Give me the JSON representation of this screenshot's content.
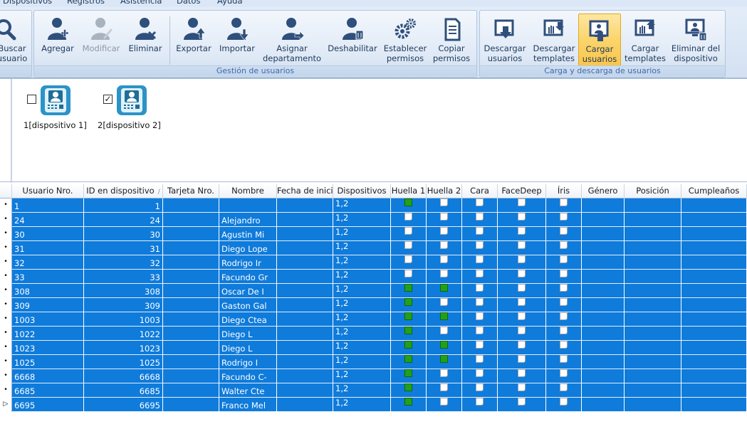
{
  "menu": [
    "Dispositivos",
    "Registros",
    "Asistencia",
    "Datos",
    "Ayuda"
  ],
  "ribbon": {
    "search": {
      "label1": "Buscar",
      "label2": "usuario"
    },
    "user_group": {
      "label": "Gestión de usuarios",
      "buttons": [
        {
          "l1": "Agregar",
          "l2": "",
          "icon": "add-user-icon",
          "disabled": false
        },
        {
          "l1": "Modificar",
          "l2": "",
          "icon": "edit-user-icon",
          "disabled": true
        },
        {
          "l1": "Eliminar",
          "l2": "",
          "icon": "delete-user-icon",
          "disabled": false
        },
        {
          "l1": "Exportar",
          "l2": "",
          "icon": "export-user-icon",
          "disabled": false
        },
        {
          "l1": "Importar",
          "l2": "",
          "icon": "import-user-icon",
          "disabled": false
        },
        {
          "l1": "Asignar",
          "l2": "departamento",
          "icon": "assign-department-icon",
          "disabled": false
        },
        {
          "l1": "Deshabilitar",
          "l2": "",
          "icon": "disable-user-icon",
          "disabled": false
        },
        {
          "l1": "Establecer",
          "l2": "permisos",
          "icon": "gears-icon",
          "disabled": false
        },
        {
          "l1": "Copiar",
          "l2": "permisos",
          "icon": "copy-document-icon",
          "disabled": false
        }
      ]
    },
    "transfer_group": {
      "label": "Carga y descarga de usuarios",
      "buttons": [
        {
          "l1": "Descargar",
          "l2": "usuarios",
          "icon": "download-users-icon"
        },
        {
          "l1": "Descargar",
          "l2": "templates",
          "icon": "download-templates-icon"
        },
        {
          "l1": "Cargar",
          "l2": "usuarios",
          "icon": "upload-users-icon"
        },
        {
          "l1": "Cargar",
          "l2": "templates",
          "icon": "upload-templates-icon"
        },
        {
          "l1": "Eliminar del",
          "l2": "dispositivo",
          "icon": "delete-from-device-icon"
        }
      ]
    },
    "colors": {
      "active": "#fbd46a",
      "icon_blue": "#2f4f7c"
    }
  },
  "devices": [
    {
      "label": "1[dispositivo 1]",
      "checked": false,
      "icon": "terminal-device-icon"
    },
    {
      "label": "2[dispositivo 2]",
      "checked": true,
      "icon": "terminal-device-icon"
    }
  ],
  "grid": {
    "columns": [
      "Usuario Nro.",
      "ID en dispositivo",
      "Tarjeta Nro.",
      "Nombre",
      "Fecha de inicio",
      "Dispositivos",
      "Huella 1",
      "Huella 2",
      "Cara",
      "FaceDeep",
      "Íris",
      "Género",
      "Posición",
      "Cumpleaños"
    ],
    "sort_marker": "/",
    "selection_color": "#0f7bdb",
    "green": "#23a01a",
    "rows": [
      {
        "user": "1",
        "id": "1",
        "card": "",
        "name": "",
        "start": "",
        "devices": "1,2",
        "h1": true,
        "h2": false,
        "face": false,
        "facedeep": false,
        "iris": false,
        "current": false
      },
      {
        "user": "24",
        "id": "24",
        "card": "",
        "name": "Alejandro",
        "start": "",
        "devices": "1,2",
        "h1": false,
        "h2": false,
        "face": false,
        "facedeep": false,
        "iris": false,
        "current": false
      },
      {
        "user": "30",
        "id": "30",
        "card": "",
        "name": "Agustin Mi",
        "start": "",
        "devices": "1,2",
        "h1": false,
        "h2": false,
        "face": false,
        "facedeep": false,
        "iris": false,
        "current": false
      },
      {
        "user": "31",
        "id": "31",
        "card": "",
        "name": "Diego Lope",
        "start": "",
        "devices": "1,2",
        "h1": false,
        "h2": false,
        "face": false,
        "facedeep": false,
        "iris": false,
        "current": false
      },
      {
        "user": "32",
        "id": "32",
        "card": "",
        "name": "Rodrigo Ir",
        "start": "",
        "devices": "1,2",
        "h1": false,
        "h2": false,
        "face": false,
        "facedeep": false,
        "iris": false,
        "current": false
      },
      {
        "user": "33",
        "id": "33",
        "card": "",
        "name": "Facundo Gr",
        "start": "",
        "devices": "1,2",
        "h1": false,
        "h2": false,
        "face": false,
        "facedeep": false,
        "iris": false,
        "current": false
      },
      {
        "user": "308",
        "id": "308",
        "card": "",
        "name": "Oscar De I",
        "start": "",
        "devices": "1,2",
        "h1": true,
        "h2": true,
        "face": false,
        "facedeep": false,
        "iris": false,
        "current": false
      },
      {
        "user": "309",
        "id": "309",
        "card": "",
        "name": "Gaston Gal",
        "start": "",
        "devices": "1,2",
        "h1": true,
        "h2": false,
        "face": false,
        "facedeep": false,
        "iris": false,
        "current": false
      },
      {
        "user": "1003",
        "id": "1003",
        "card": "",
        "name": "Diego Ctea",
        "start": "",
        "devices": "1,2",
        "h1": true,
        "h2": true,
        "face": false,
        "facedeep": false,
        "iris": false,
        "current": false
      },
      {
        "user": "1022",
        "id": "1022",
        "card": "",
        "name": "Diego L",
        "start": "",
        "devices": "1,2",
        "h1": true,
        "h2": false,
        "face": false,
        "facedeep": false,
        "iris": false,
        "current": false
      },
      {
        "user": "1023",
        "id": "1023",
        "card": "",
        "name": "Diego L",
        "start": "",
        "devices": "1,2",
        "h1": true,
        "h2": true,
        "face": false,
        "facedeep": false,
        "iris": false,
        "current": false
      },
      {
        "user": "1025",
        "id": "1025",
        "card": "",
        "name": "Rodrigo I",
        "start": "",
        "devices": "1,2",
        "h1": true,
        "h2": true,
        "face": false,
        "facedeep": false,
        "iris": false,
        "current": false
      },
      {
        "user": "6668",
        "id": "6668",
        "card": "",
        "name": "Facundo C-",
        "start": "",
        "devices": "1,2",
        "h1": true,
        "h2": false,
        "face": false,
        "facedeep": false,
        "iris": false,
        "current": false
      },
      {
        "user": "6685",
        "id": "6685",
        "card": "",
        "name": "Walter Cte",
        "start": "",
        "devices": "1,2",
        "h1": true,
        "h2": false,
        "face": false,
        "facedeep": false,
        "iris": false,
        "current": false
      },
      {
        "user": "6695",
        "id": "6695",
        "card": "",
        "name": "Franco Mel",
        "start": "",
        "devices": "1,2",
        "h1": true,
        "h2": false,
        "face": false,
        "facedeep": false,
        "iris": false,
        "current": true
      }
    ]
  }
}
